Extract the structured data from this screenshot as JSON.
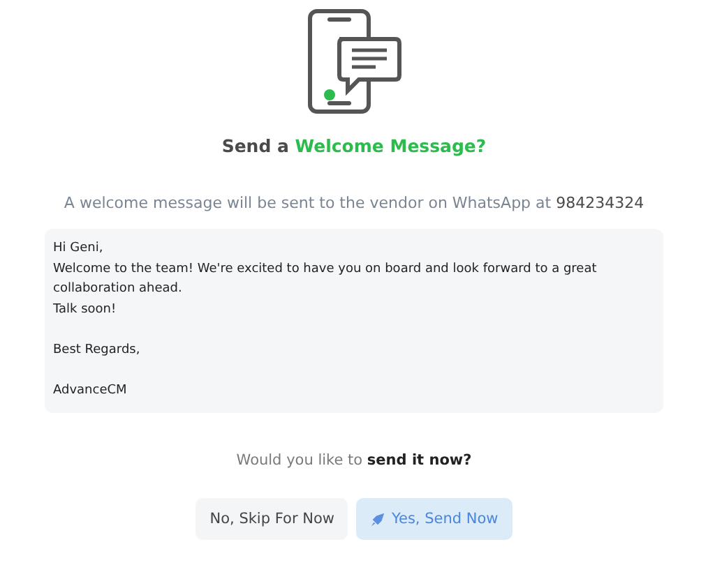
{
  "title": {
    "lead": "Send a",
    "highlight": "Welcome Message?"
  },
  "subtitle": {
    "text": "A welcome message will be sent to the vendor on WhatsApp at",
    "phone": "984234324"
  },
  "message": {
    "value": "Hi Geni,\nWelcome to the team! We're excited to have you on board and look forward to a great collaboration ahead.\nTalk soon!\n\nBest Regards,\n\nAdvanceCM"
  },
  "question": {
    "text": "Would you like to",
    "emphasis": "send it now?"
  },
  "buttons": [
    {
      "label": "No, Skip For Now",
      "kind": "secondary"
    },
    {
      "label": "Yes, Send Now",
      "kind": "primary"
    }
  ]
}
